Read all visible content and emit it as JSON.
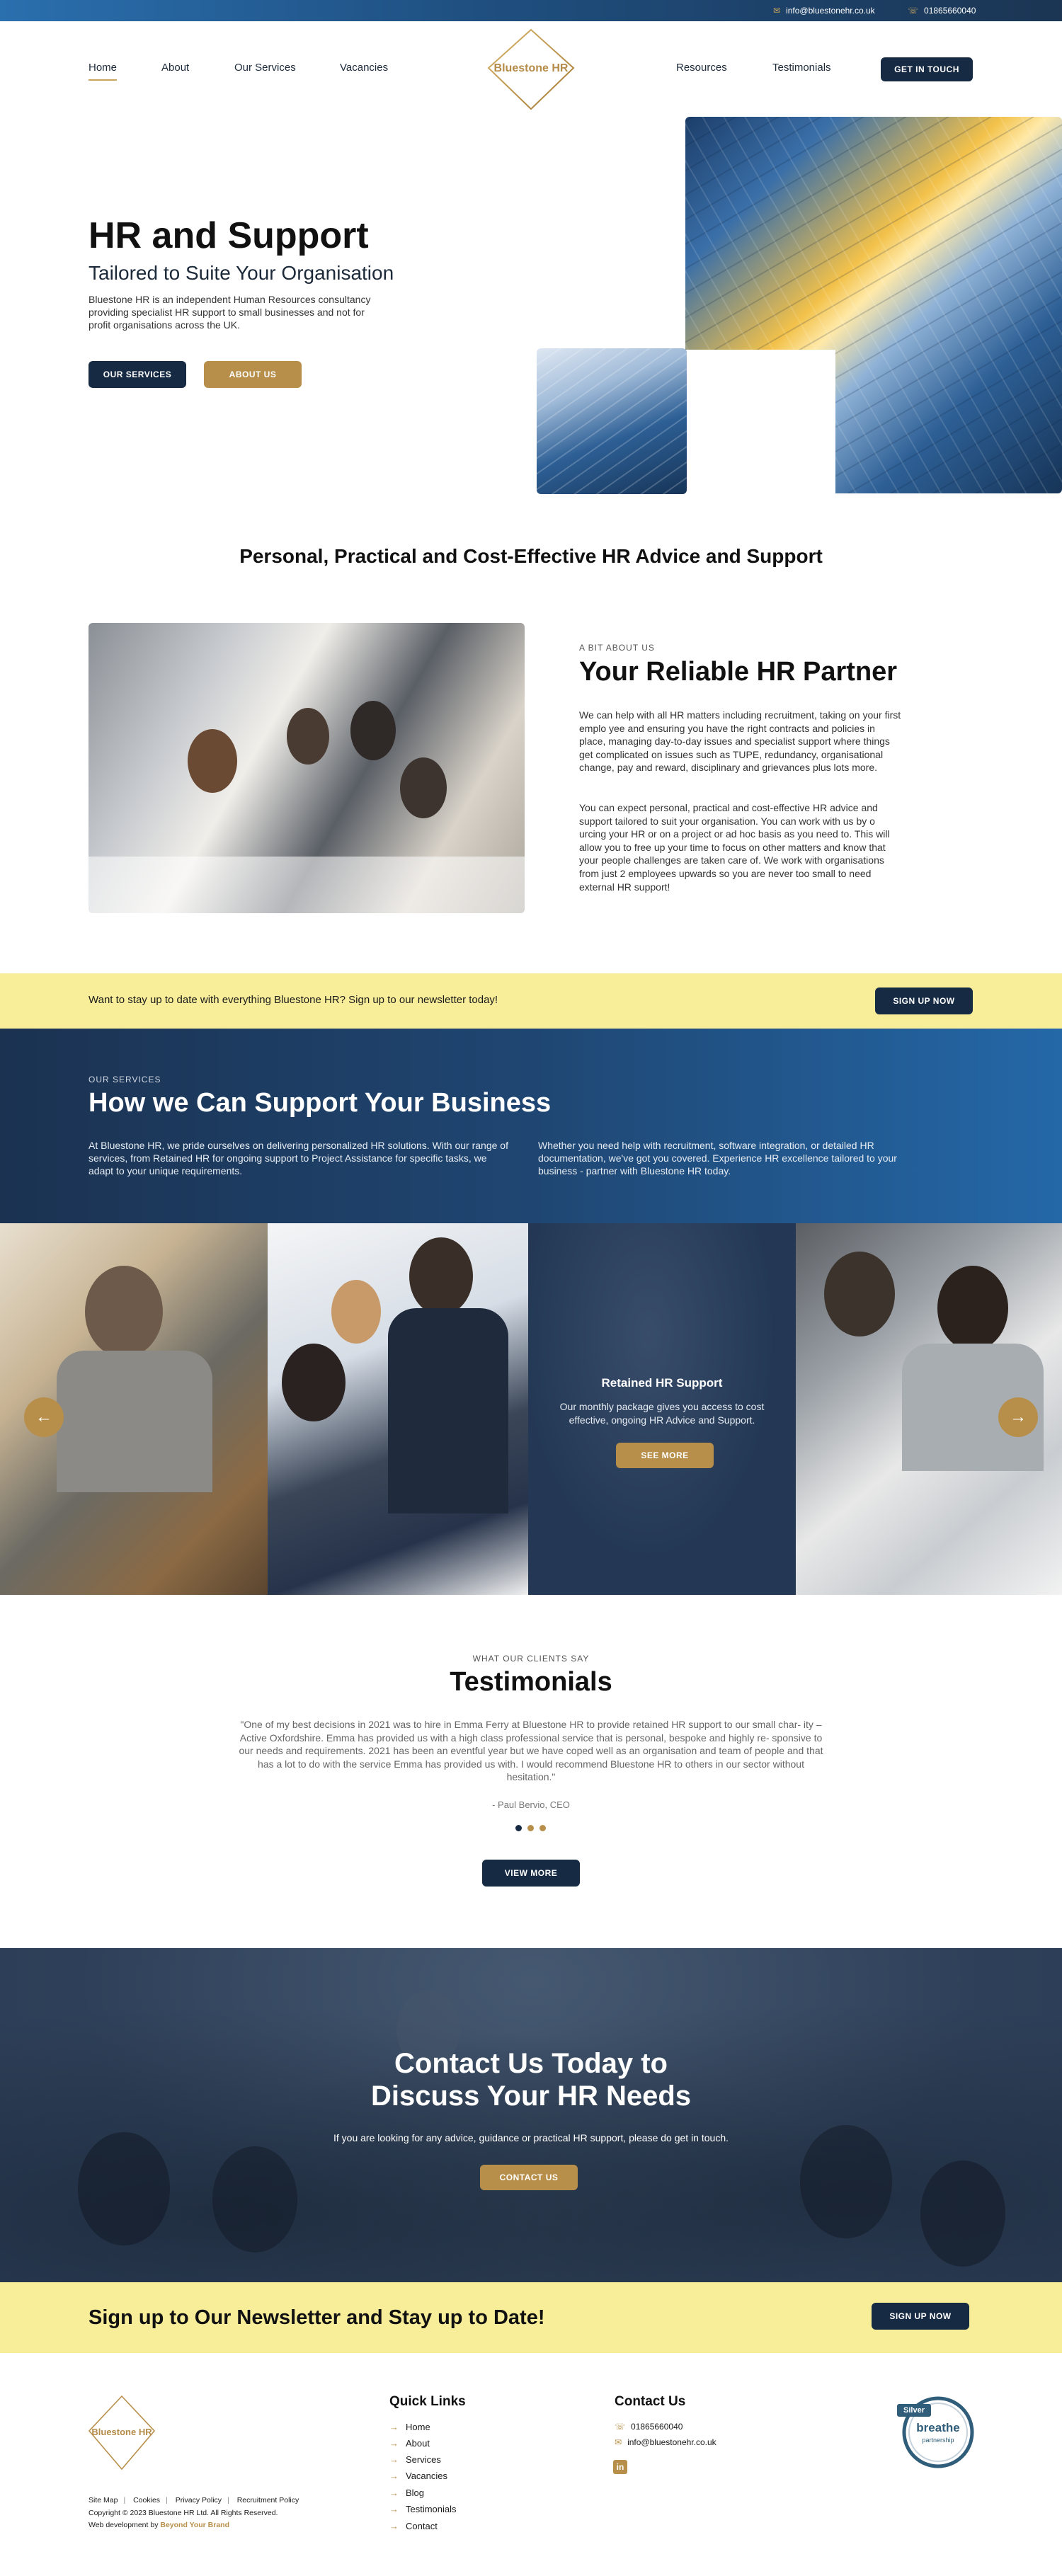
{
  "topbar": {
    "email": "info@bluestonehr.co.uk",
    "phone": "01865660040",
    "email_icon": "mail-icon",
    "phone_icon": "phone-icon"
  },
  "nav": {
    "home": "Home",
    "about": "About",
    "services": "Our Services",
    "vacancies": "Vacancies",
    "resources": "Resources",
    "testimonials": "Testimonials",
    "cta": "GET IN TOUCH"
  },
  "brand": {
    "name": "Bluestone HR",
    "gold": "#b78f4a",
    "navy": "#162a43",
    "yellow": "#f8ee9a"
  },
  "hero": {
    "title": "HR and Support",
    "subtitle": "Tailored to Suite Your Organisation",
    "description": "Bluestone HR is an independent Human Resources consultancy providing specialist HR support to small businesses and not for profit organisations across the UK.",
    "btn_services": "OUR SERVICES",
    "btn_about": "ABOUT US"
  },
  "tagline": "Personal, Practical and Cost-Effective HR Advice and Support",
  "about": {
    "kicker": "A BIT ABOUT US",
    "title": "Your Reliable HR Partner",
    "p1": "We can help with all HR matters including recruitment, taking on your first emplo yee and ensuring you have the right contracts and policies in place, managing day-to-day issues and specialist support where things get complicated on issues such as TUPE, redundancy, organisational change, pay and reward, disciplinary and grievances plus lots more.",
    "p2": "You can expect personal, practical and cost-effective HR advice and support tailored to suit your organisation. You can work with us by o urcing your HR or on a project or ad hoc basis as you need to. This will allow you to free up your time to focus on other matters and know that your people challenges are taken care of. We work with organisations from just 2 employees upwards so you are never too small to need external HR support!"
  },
  "newsletter_strip": {
    "text": "Want to stay up to date with everything Bluestone HR? Sign up to our newsletter today!",
    "button": "SIGN UP NOW"
  },
  "services": {
    "kicker": "OUR SERVICES",
    "title": "How we Can Support Your Business",
    "p_left": "At Bluestone HR, we pride ourselves on delivering personalized HR solutions. With our range of services, from Retained HR for ongoing support to Project Assistance for specific tasks, we adapt to your unique requirements.",
    "p_right": "Whether you need help with recruitment, software integration, or detailed HR documentation, we've got you covered. Experience HR excellence tailored to your business - partner with Bluestone HR today.",
    "card_title": "Retained HR Support",
    "card_desc": "Our monthly package gives you access to cost effective, ongoing HR Advice and Support.",
    "card_button": "SEE MORE",
    "prev_icon": "arrow-left-icon",
    "next_icon": "arrow-right-icon"
  },
  "testimonials": {
    "kicker": "WHAT OUR CLIENTS SAY",
    "title": "Testimonials",
    "quote": "\"One of my best decisions in 2021 was to hire in Emma Ferry at Bluestone HR to provide retained HR support to our small char- ity – Active Oxfordshire. Emma has provided us with a high class professional service that is personal, bespoke and highly re- sponsive to our needs and requirements. 2021 has been an eventful year but we have coped well as an organisation and team of people and that has a lot to do with the service Emma has provided us with. I would recommend Bluestone HR to others in our sector without hesitation.\"",
    "author": "- Paul Bervio, CEO",
    "button": "VIEW MORE"
  },
  "contact": {
    "title_line1": "Contact Us Today to",
    "title_line2": "Discuss Your HR Needs",
    "description": "If you are looking for any advice, guidance or practical HR support, please do get in touch.",
    "button": "CONTACT US"
  },
  "newsletter_big": {
    "text": "Sign up to Our Newsletter and Stay up to Date!",
    "button": "SIGN UP NOW"
  },
  "footer": {
    "legal": [
      "Site Map",
      "Cookies",
      "Privacy Policy",
      "Recruitment Policy"
    ],
    "copyright": "Copyright © 2023 Bluestone HR Ltd. All Rights Reserved.",
    "webdev_prefix": "Web development by",
    "webdev_name": "Beyond Your Brand",
    "quick_links_title": "Quick Links",
    "quick_links": [
      "Home",
      "About",
      "Services",
      "Vacancies",
      "Blog",
      "Testimonials",
      "Contact"
    ],
    "contact_title": "Contact Us",
    "phone": "01865660040",
    "email": "info@bluestonehr.co.uk",
    "linkedin_icon": "linkedin-icon",
    "badge_label": "Silver",
    "badge_brand": "breathe",
    "badge_sub": "partnership"
  }
}
